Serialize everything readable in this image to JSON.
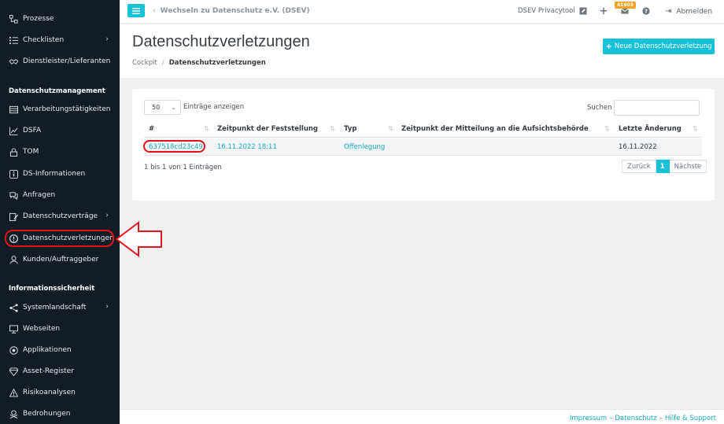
{
  "sidebar": {
    "items": [
      {
        "label": "Prozesse",
        "icon": "process-icon",
        "chevron": false
      },
      {
        "label": "Checklisten",
        "icon": "list-icon",
        "chevron": true
      },
      {
        "label": "Dienstleister/Lieferanten",
        "icon": "handshake-icon",
        "chevron": false
      }
    ],
    "section1": "Datenschutzmanagement",
    "items2": [
      {
        "label": "Verarbeitungstätigkeiten",
        "icon": "table-icon",
        "chevron": false
      },
      {
        "label": "DSFA",
        "icon": "chart-icon",
        "chevron": false
      },
      {
        "label": "TOM",
        "icon": "lock-icon",
        "chevron": false
      },
      {
        "label": "DS-Informationen",
        "icon": "info-box-icon",
        "chevron": false
      },
      {
        "label": "Anfragen",
        "icon": "chat-icon",
        "chevron": false
      },
      {
        "label": "Datenschutzverträge",
        "icon": "contract-icon",
        "chevron": true
      },
      {
        "label": "Datenschutzverletzungen",
        "icon": "alert-circle-icon",
        "chevron": false
      },
      {
        "label": "Kunden/Auftraggeber",
        "icon": "user-icon",
        "chevron": false
      }
    ],
    "section2": "Informationssicherheit",
    "items3": [
      {
        "label": "Systemlandschaft",
        "icon": "network-icon",
        "chevron": true
      },
      {
        "label": "Webseiten",
        "icon": "monitor-icon",
        "chevron": false
      },
      {
        "label": "Applikationen",
        "icon": "app-icon",
        "chevron": false
      },
      {
        "label": "Asset-Register",
        "icon": "diamond-icon",
        "chevron": false
      },
      {
        "label": "Risikoanalysen",
        "icon": "warning-icon",
        "chevron": false
      },
      {
        "label": "Bedrohungen",
        "icon": "threat-icon",
        "chevron": false
      }
    ]
  },
  "topbar": {
    "switch_label": "Wechseln zu Datenschutz e.V. (DSEV)",
    "tool_name": "DSEV Privacytool",
    "mail_badge": "41603",
    "logout_label": "Abmelden"
  },
  "header": {
    "title": "Datenschutzverletzungen",
    "breadcrumb_root": "Cockpit",
    "breadcrumb_current": "Datenschutzverletzungen",
    "new_button": "Neue Datenschutzverletzung"
  },
  "table": {
    "length_value": "50",
    "length_label": "Einträge anzeigen",
    "search_label": "Suchen",
    "columns": [
      "#",
      "Zeitpunkt der Feststellung",
      "Typ",
      "Zeitpunkt der Mitteilung an die Aufsichtsbehörde",
      "Letzte Änderung"
    ],
    "rows": [
      {
        "id": "637518cd23c49",
        "found": "16.11.2022 18:11",
        "type": "Offenlegung",
        "reported": "",
        "changed": "16.11.2022"
      }
    ],
    "info": "1 bis 1 von 1 Einträgen",
    "prev": "Zurück",
    "page": "1",
    "next": "Nächste"
  },
  "footer": {
    "impressum": "Impressum",
    "datenschutz": "Datenschutz",
    "hilfe": "Hilfe & Support",
    "sep": "–"
  },
  "colors": {
    "accent": "#17c1d8",
    "sidebar_bg": "#111c25",
    "annotation": "#e0151b"
  }
}
